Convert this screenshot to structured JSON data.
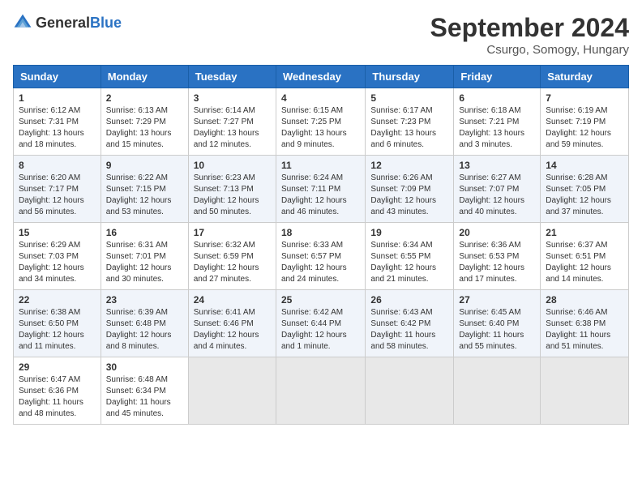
{
  "header": {
    "logo_general": "General",
    "logo_blue": "Blue",
    "month_title": "September 2024",
    "location": "Csurgo, Somogy, Hungary"
  },
  "days_of_week": [
    "Sunday",
    "Monday",
    "Tuesday",
    "Wednesday",
    "Thursday",
    "Friday",
    "Saturday"
  ],
  "weeks": [
    [
      {
        "day": "1",
        "info": "Sunrise: 6:12 AM\nSunset: 7:31 PM\nDaylight: 13 hours\nand 18 minutes."
      },
      {
        "day": "2",
        "info": "Sunrise: 6:13 AM\nSunset: 7:29 PM\nDaylight: 13 hours\nand 15 minutes."
      },
      {
        "day": "3",
        "info": "Sunrise: 6:14 AM\nSunset: 7:27 PM\nDaylight: 13 hours\nand 12 minutes."
      },
      {
        "day": "4",
        "info": "Sunrise: 6:15 AM\nSunset: 7:25 PM\nDaylight: 13 hours\nand 9 minutes."
      },
      {
        "day": "5",
        "info": "Sunrise: 6:17 AM\nSunset: 7:23 PM\nDaylight: 13 hours\nand 6 minutes."
      },
      {
        "day": "6",
        "info": "Sunrise: 6:18 AM\nSunset: 7:21 PM\nDaylight: 13 hours\nand 3 minutes."
      },
      {
        "day": "7",
        "info": "Sunrise: 6:19 AM\nSunset: 7:19 PM\nDaylight: 12 hours\nand 59 minutes."
      }
    ],
    [
      {
        "day": "8",
        "info": "Sunrise: 6:20 AM\nSunset: 7:17 PM\nDaylight: 12 hours\nand 56 minutes."
      },
      {
        "day": "9",
        "info": "Sunrise: 6:22 AM\nSunset: 7:15 PM\nDaylight: 12 hours\nand 53 minutes."
      },
      {
        "day": "10",
        "info": "Sunrise: 6:23 AM\nSunset: 7:13 PM\nDaylight: 12 hours\nand 50 minutes."
      },
      {
        "day": "11",
        "info": "Sunrise: 6:24 AM\nSunset: 7:11 PM\nDaylight: 12 hours\nand 46 minutes."
      },
      {
        "day": "12",
        "info": "Sunrise: 6:26 AM\nSunset: 7:09 PM\nDaylight: 12 hours\nand 43 minutes."
      },
      {
        "day": "13",
        "info": "Sunrise: 6:27 AM\nSunset: 7:07 PM\nDaylight: 12 hours\nand 40 minutes."
      },
      {
        "day": "14",
        "info": "Sunrise: 6:28 AM\nSunset: 7:05 PM\nDaylight: 12 hours\nand 37 minutes."
      }
    ],
    [
      {
        "day": "15",
        "info": "Sunrise: 6:29 AM\nSunset: 7:03 PM\nDaylight: 12 hours\nand 34 minutes."
      },
      {
        "day": "16",
        "info": "Sunrise: 6:31 AM\nSunset: 7:01 PM\nDaylight: 12 hours\nand 30 minutes."
      },
      {
        "day": "17",
        "info": "Sunrise: 6:32 AM\nSunset: 6:59 PM\nDaylight: 12 hours\nand 27 minutes."
      },
      {
        "day": "18",
        "info": "Sunrise: 6:33 AM\nSunset: 6:57 PM\nDaylight: 12 hours\nand 24 minutes."
      },
      {
        "day": "19",
        "info": "Sunrise: 6:34 AM\nSunset: 6:55 PM\nDaylight: 12 hours\nand 21 minutes."
      },
      {
        "day": "20",
        "info": "Sunrise: 6:36 AM\nSunset: 6:53 PM\nDaylight: 12 hours\nand 17 minutes."
      },
      {
        "day": "21",
        "info": "Sunrise: 6:37 AM\nSunset: 6:51 PM\nDaylight: 12 hours\nand 14 minutes."
      }
    ],
    [
      {
        "day": "22",
        "info": "Sunrise: 6:38 AM\nSunset: 6:50 PM\nDaylight: 12 hours\nand 11 minutes."
      },
      {
        "day": "23",
        "info": "Sunrise: 6:39 AM\nSunset: 6:48 PM\nDaylight: 12 hours\nand 8 minutes."
      },
      {
        "day": "24",
        "info": "Sunrise: 6:41 AM\nSunset: 6:46 PM\nDaylight: 12 hours\nand 4 minutes."
      },
      {
        "day": "25",
        "info": "Sunrise: 6:42 AM\nSunset: 6:44 PM\nDaylight: 12 hours\nand 1 minute."
      },
      {
        "day": "26",
        "info": "Sunrise: 6:43 AM\nSunset: 6:42 PM\nDaylight: 11 hours\nand 58 minutes."
      },
      {
        "day": "27",
        "info": "Sunrise: 6:45 AM\nSunset: 6:40 PM\nDaylight: 11 hours\nand 55 minutes."
      },
      {
        "day": "28",
        "info": "Sunrise: 6:46 AM\nSunset: 6:38 PM\nDaylight: 11 hours\nand 51 minutes."
      }
    ],
    [
      {
        "day": "29",
        "info": "Sunrise: 6:47 AM\nSunset: 6:36 PM\nDaylight: 11 hours\nand 48 minutes."
      },
      {
        "day": "30",
        "info": "Sunrise: 6:48 AM\nSunset: 6:34 PM\nDaylight: 11 hours\nand 45 minutes."
      },
      {
        "day": "",
        "info": ""
      },
      {
        "day": "",
        "info": ""
      },
      {
        "day": "",
        "info": ""
      },
      {
        "day": "",
        "info": ""
      },
      {
        "day": "",
        "info": ""
      }
    ]
  ]
}
